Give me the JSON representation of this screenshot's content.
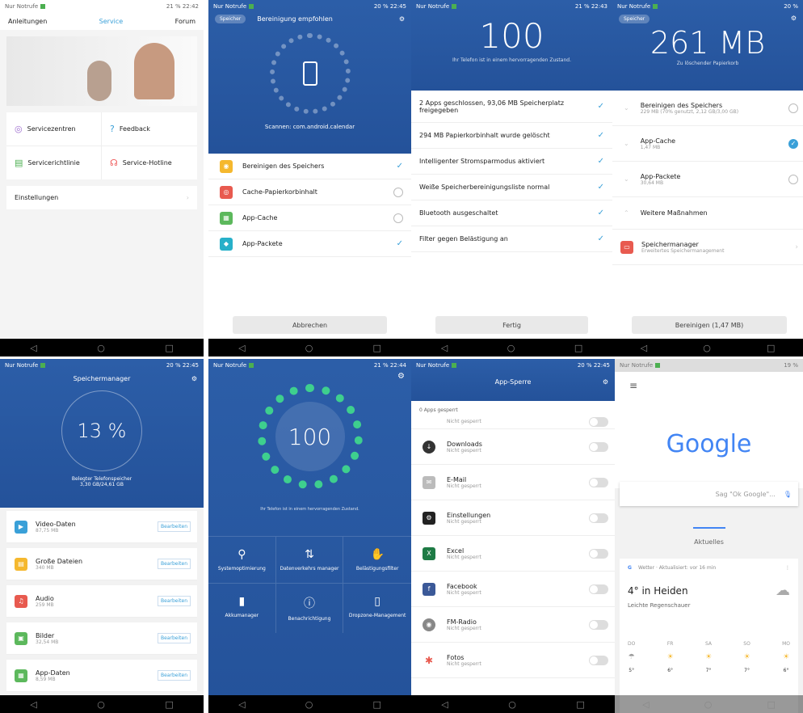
{
  "status": {
    "carrier": "Nur Notrufe",
    "s0": "21 %  22:42",
    "s1": "20 %  22:45",
    "s2": "21 %  22:43",
    "s3": "20 %",
    "s4": "20 %  22:45",
    "s5": "21 %  22:44",
    "s6": "20 %  22:45",
    "s7": "19 %"
  },
  "s0": {
    "tabs": [
      "Anleitungen",
      "Service",
      "Forum"
    ],
    "grid": [
      "Servicezentren",
      "Feedback",
      "Servicerichtlinie",
      "Service-Hotline"
    ],
    "settings": "Einstellungen"
  },
  "s1": {
    "pill": "Speicher",
    "title": "Bereinigung empfohlen",
    "scan": "Scannen: com.android.calendar",
    "items": [
      "Bereinigen des Speichers",
      "Cache-Papierkorbinhalt",
      "App-Cache",
      "App-Packete"
    ],
    "button": "Abbrechen"
  },
  "s2": {
    "score": "100",
    "sub": "Ihr Telefon ist in einem hervorragenden Zustand.",
    "items": [
      "2 Apps geschlossen, 93,06 MB Speicherplatz freigegeben",
      "294 MB Papierkorbinhalt wurde gelöscht",
      "Intelligenter Stromsparmodus aktiviert",
      "Weiße Speicherbereinigungsliste normal",
      "Bluetooth ausgeschaltet",
      "Filter gegen Belästigung an"
    ],
    "button": "Fertig"
  },
  "s3": {
    "pill": "Speicher",
    "size": "261 MB",
    "sub": "Zu löschender Papierkorb",
    "items": [
      {
        "title": "Bereinigen des Speichers",
        "sub": "229 MB (70% genutzt, 2,12 GB/3,00 GB)"
      },
      {
        "title": "App-Cache",
        "sub": "1,47 MB"
      },
      {
        "title": "App-Packete",
        "sub": "30,64 MB"
      },
      {
        "title": "Weitere Maßnahmen",
        "sub": ""
      }
    ],
    "manager": "Speichermanager",
    "manager_sub": "Erweitertes Speichermanagement",
    "button": "Bereinigen (1,47 MB)"
  },
  "s4": {
    "title": "Speichermanager",
    "percent": "13 %",
    "label": "Belegter Telefonspeicher",
    "value": "3,30 GB/24,61 GB",
    "items": [
      {
        "title": "Video-Daten",
        "size": "87,75 MB"
      },
      {
        "title": "Große Dateien",
        "size": "340 MB"
      },
      {
        "title": "Audio",
        "size": "259 MB"
      },
      {
        "title": "Bilder",
        "size": "32,54 MB"
      },
      {
        "title": "App-Daten",
        "size": "8,59 MB"
      }
    ],
    "edit": "Bearbeiten"
  },
  "s5": {
    "score": "100",
    "sub": "Ihr Telefon ist in einem hervorragenden Zustand.",
    "tools": [
      "Systemoptimierung",
      "Datenverkehrs manager",
      "Belästigungsfilter",
      "Akkumanager",
      "Benachrichtigung",
      "Dropzone-Management"
    ]
  },
  "s6": {
    "title": "App-Sperre",
    "count": "0 Apps gesperrt",
    "locked": "Nicht gesperrt",
    "apps": [
      "Downloads",
      "E-Mail",
      "Einstellungen",
      "Excel",
      "Facebook",
      "FM-Radio",
      "Fotos"
    ]
  },
  "s7": {
    "logo": "Google",
    "search": "Sag \"Ok Google\"...",
    "tab": "Aktuelles",
    "weather_src": "Wetter · Aktualisiert: vor 16 min",
    "temp": "4° in Heiden",
    "cond": "Leichte Regenschauer",
    "days": [
      "DO",
      "FR",
      "SA",
      "SO",
      "MO"
    ],
    "temps": [
      "5°",
      "6°",
      "7°",
      "7°",
      "6°"
    ]
  },
  "colors": {
    "accent": "#2c5ea8",
    "check": "#3aa0d8"
  }
}
